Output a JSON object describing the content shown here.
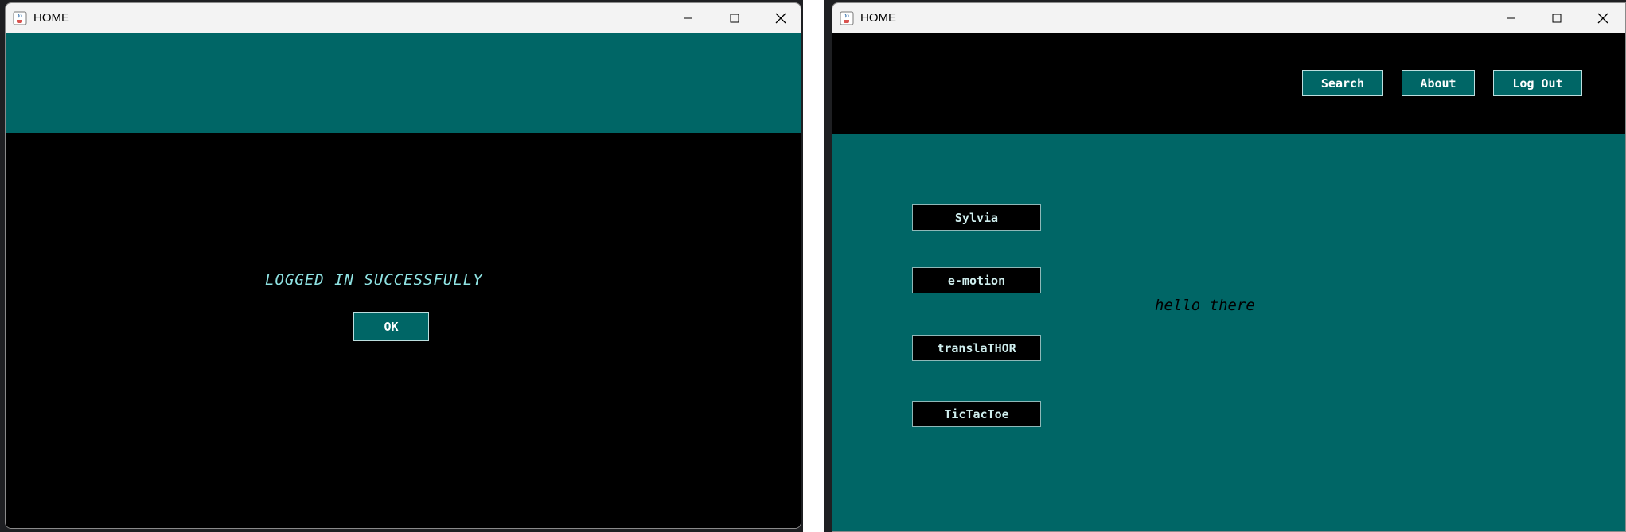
{
  "left_window": {
    "title": "HOME",
    "message": "LOGGED IN SUCCESSFULLY",
    "ok_label": "OK"
  },
  "right_window": {
    "title": "HOME",
    "nav": {
      "search_label": "Search",
      "about_label": "About",
      "logout_label": "Log Out"
    },
    "apps": [
      {
        "label": "Sylvia"
      },
      {
        "label": "e-motion"
      },
      {
        "label": "translaTHOR"
      },
      {
        "label": "TicTacToe"
      }
    ],
    "greeting": "hello there"
  },
  "colors": {
    "teal": "#006666",
    "accent_text": "#8fe3e3",
    "black": "#000000"
  },
  "icons": {
    "app_icon": "java-cup-icon",
    "minimize": "minimize-icon",
    "maximize": "maximize-icon",
    "close": "close-icon"
  }
}
